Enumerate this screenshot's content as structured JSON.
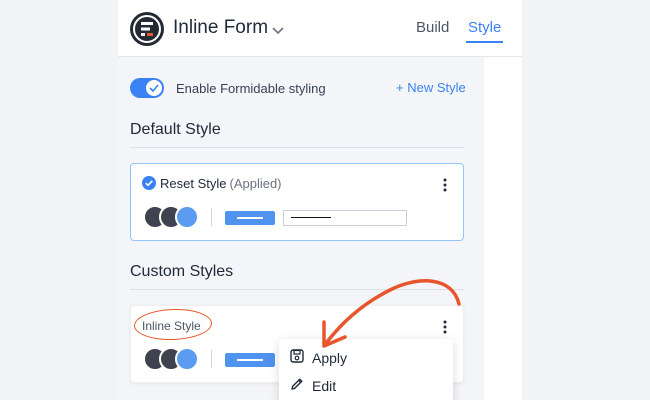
{
  "header": {
    "form_title": "Inline Form",
    "tabs": [
      {
        "label": "Build",
        "active": false
      },
      {
        "label": "Style",
        "active": true
      }
    ]
  },
  "toolbar": {
    "toggle_label": "Enable Formidable styling",
    "toggle_on": true,
    "new_style_label": "+ New Style"
  },
  "default_section": {
    "title": "Default Style",
    "card": {
      "name": "Reset Style",
      "status": "(Applied)",
      "swatch_colors": [
        "#3f4350",
        "#3f4350",
        "#5b9bf0"
      ]
    }
  },
  "custom_section": {
    "title": "Custom Styles",
    "card": {
      "name": "Inline Style",
      "swatch_colors": [
        "#3f4350",
        "#3f4350",
        "#5b9bf0"
      ]
    }
  },
  "context_menu": {
    "items": [
      {
        "label": "Apply",
        "icon": "save-icon"
      },
      {
        "label": "Edit",
        "icon": "pencil-icon"
      }
    ]
  },
  "colors": {
    "accent": "#3b82f6",
    "annotation": "#e8552c"
  }
}
